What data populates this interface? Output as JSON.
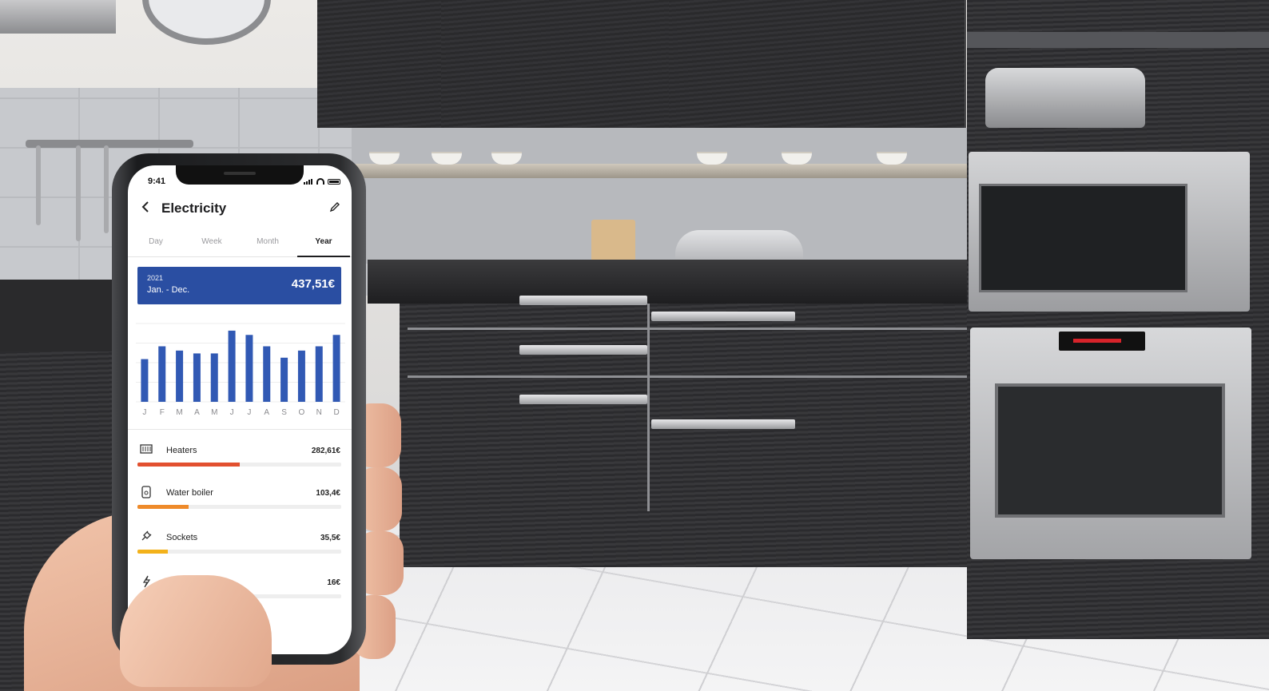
{
  "status_bar": {
    "time": "9:41"
  },
  "header": {
    "title": "Electricity",
    "back_icon": "chevron-left-icon",
    "edit_icon": "pencil-icon"
  },
  "tabs": [
    {
      "label": "Day",
      "active": false
    },
    {
      "label": "Week",
      "active": false
    },
    {
      "label": "Month",
      "active": false
    },
    {
      "label": "Year",
      "active": true
    }
  ],
  "summary": {
    "year": "2021",
    "range": "Jan. - Dec.",
    "total": "437,51€",
    "color": "#2a4ea2"
  },
  "chart_data": {
    "type": "bar",
    "categories": [
      "J",
      "F",
      "M",
      "A",
      "M",
      "J",
      "J",
      "A",
      "S",
      "O",
      "N",
      "D"
    ],
    "values": [
      30,
      39,
      36,
      34,
      34,
      50,
      47,
      39,
      31,
      36,
      39,
      47
    ],
    "ylim": [
      0,
      55
    ],
    "bar_color": "#3159b4",
    "grid": true
  },
  "categories": [
    {
      "icon": "heater-icon",
      "label": "Heaters",
      "value": "282,61€",
      "share": 0.5,
      "color": "#e2502f"
    },
    {
      "icon": "water-boiler-icon",
      "label": "Water boiler",
      "value": "103,4€",
      "share": 0.25,
      "color": "#ee8a2a"
    },
    {
      "icon": "socket-icon",
      "label": "Sockets",
      "value": "35,5€",
      "share": 0.15,
      "color": "#f3b21b"
    },
    {
      "icon": "lightning-icon",
      "label": "",
      "value": "16€",
      "share": 0.06,
      "color": "#f5c43a"
    }
  ]
}
